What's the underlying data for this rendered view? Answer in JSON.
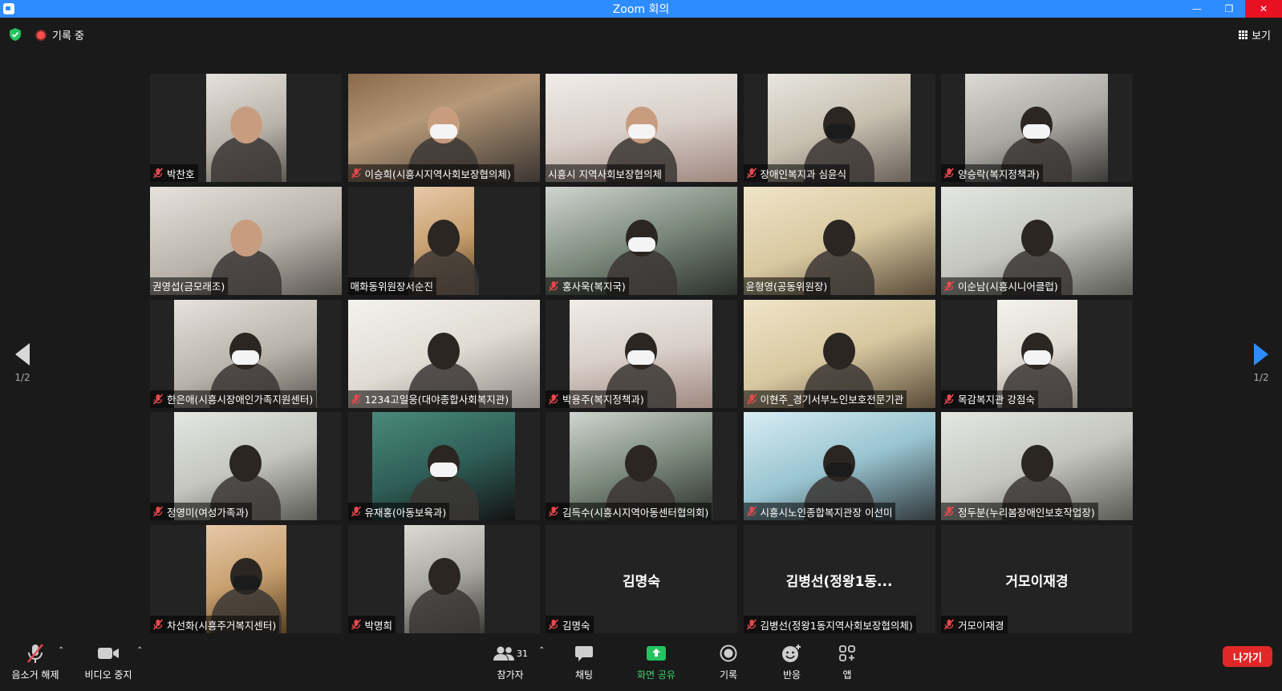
{
  "window": {
    "title": "Zoom 회의"
  },
  "topbar": {
    "recording_label": "기록 중",
    "view_label": "보기"
  },
  "pagination": {
    "left_label": "1/2",
    "right_label": "1/2"
  },
  "tiles": [
    {
      "name": "박찬호",
      "muted": true,
      "big": ""
    },
    {
      "name": "이승희(시흥시지역사회보장협의체)",
      "muted": true,
      "big": ""
    },
    {
      "name": "시흥시 지역사회보장협의체",
      "muted": false,
      "big": ""
    },
    {
      "name": "장애인복지과 심윤식",
      "muted": true,
      "big": ""
    },
    {
      "name": "양승락(복지정책과)",
      "muted": true,
      "big": ""
    },
    {
      "name": "권영섭(금모래조)",
      "muted": false,
      "big": ""
    },
    {
      "name": "매화동위원장서순진",
      "muted": false,
      "big": ""
    },
    {
      "name": "홍사욱(복지국)",
      "muted": true,
      "big": ""
    },
    {
      "name": "윤형영(공동위원장)",
      "muted": false,
      "big": ""
    },
    {
      "name": "이순남(시흥시니어클럽)",
      "muted": true,
      "big": ""
    },
    {
      "name": "한은애(시흥시장애인가족지원센터)",
      "muted": true,
      "big": ""
    },
    {
      "name": "1234고일웅(대야종합사회복지관)",
      "muted": true,
      "big": ""
    },
    {
      "name": "박용주(복지정책과)",
      "muted": true,
      "big": ""
    },
    {
      "name": "이현주_경기서부노인보호전문기관",
      "muted": true,
      "big": ""
    },
    {
      "name": "목감복지관 강점숙",
      "muted": true,
      "big": ""
    },
    {
      "name": "정영미(여성가족과)",
      "muted": true,
      "big": ""
    },
    {
      "name": "유재홍(아동보육과)",
      "muted": true,
      "big": ""
    },
    {
      "name": "김득수(시흥시지역아동센터협의회)",
      "muted": true,
      "big": ""
    },
    {
      "name": "시흥시노인종합복지관장 이선미",
      "muted": true,
      "big": ""
    },
    {
      "name": "정두분(누리봄장애인보호작업장)",
      "muted": true,
      "big": ""
    },
    {
      "name": "차선화(시흥주거복지센터)",
      "muted": true,
      "big": ""
    },
    {
      "name": "박명희",
      "muted": true,
      "big": ""
    },
    {
      "name": "김명숙",
      "muted": true,
      "big": "김명숙"
    },
    {
      "name": "김병선(정왕1동지역사회보장협의체)",
      "muted": true,
      "big": "김병선(정왕1동..."
    },
    {
      "name": "거모이재경",
      "muted": true,
      "big": "거모이재경"
    }
  ],
  "toolbar": {
    "unmute_label": "음소거 해제",
    "video_label": "비디오 중지",
    "participants_label": "참가자",
    "participants_count": "31",
    "chat_label": "채팅",
    "share_label": "화면 공유",
    "record_label": "기록",
    "reactions_label": "반응",
    "apps_label": "앱",
    "leave_label": "나가기"
  },
  "colors": {
    "accent": "#2d8cff",
    "speaker_border": "#c6e64a",
    "share_green": "#3ed16d",
    "leave_red": "#e02828",
    "mute_red": "#e5484d"
  }
}
